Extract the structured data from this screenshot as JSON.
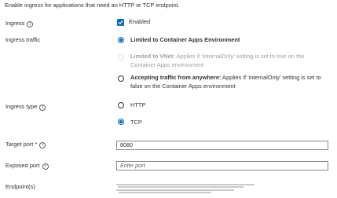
{
  "intro_text": "Enable ingress for applications that need an HTTP or TCP endpoint.",
  "ingress": {
    "label": "Ingress",
    "value_label": "Enabled",
    "checked": true
  },
  "ingress_traffic": {
    "label": "Ingress traffic",
    "options": [
      {
        "bold": "Limited to Container Apps Environment",
        "desc_line1": "",
        "desc_line2": "",
        "selected": true,
        "disabled": false
      },
      {
        "bold": "Limited to VNet:",
        "desc_line1": " Applies if 'internalOnly' setting is set to true on the",
        "desc_line2": "Container Apps environment",
        "selected": false,
        "disabled": true
      },
      {
        "bold": "Accepting traffic from anywhere:",
        "desc_line1": " Applies if 'internalOnly' setting is set to",
        "desc_line2": "false on the Container Apps environment",
        "selected": false,
        "disabled": false
      }
    ]
  },
  "ingress_type": {
    "label": "Ingress type",
    "options": [
      {
        "label": "HTTP",
        "selected": false
      },
      {
        "label": "TCP",
        "selected": true
      }
    ]
  },
  "target_port": {
    "label": "Target port *",
    "value": "8080"
  },
  "exposed_port": {
    "label": "Exposed port",
    "placeholder": "Enter port",
    "value": ""
  },
  "endpoints": {
    "label": "Endpoint(s)"
  },
  "colors": {
    "accent": "#0f6cbd",
    "text": "#323130",
    "disabled": "#a19f9d"
  }
}
